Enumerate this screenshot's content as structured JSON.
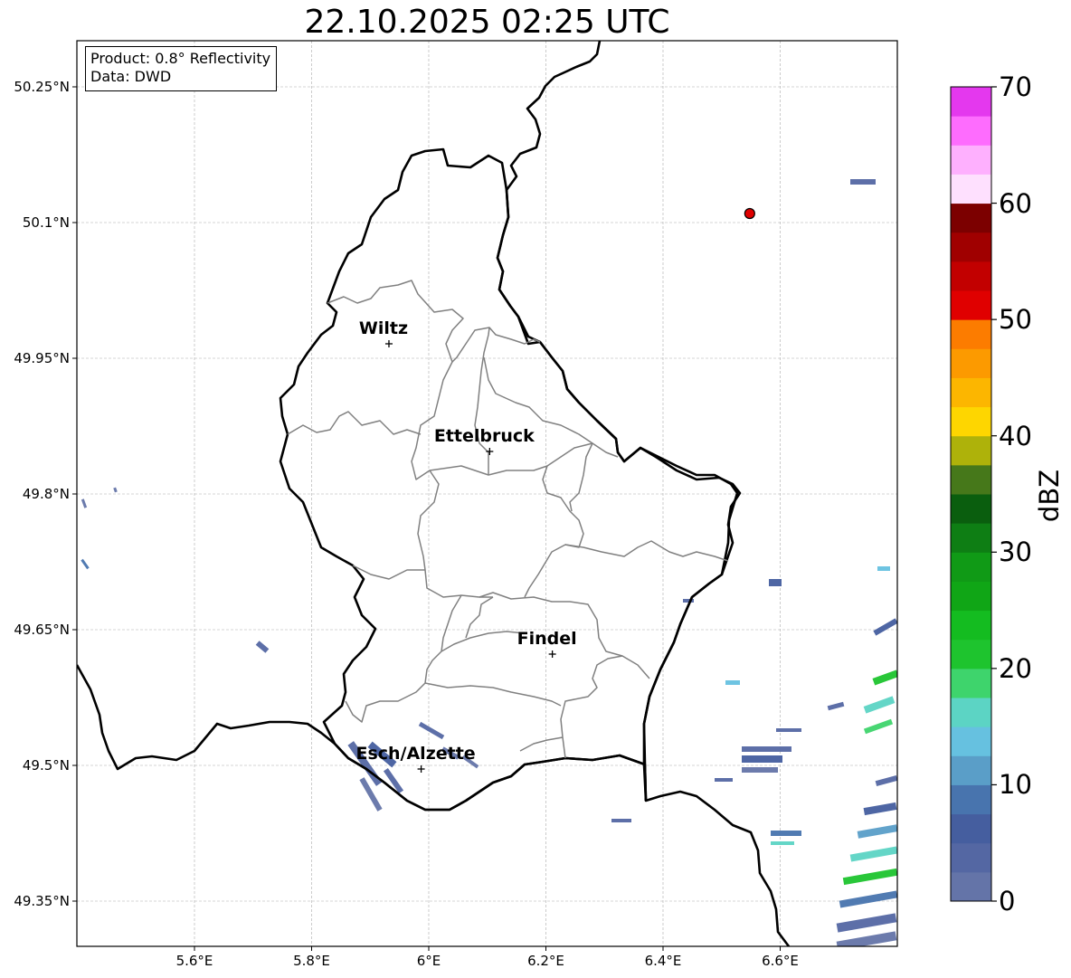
{
  "title": "22.10.2025 02:25 UTC",
  "info_box": {
    "product": "Product: 0.8° Reflectivity",
    "data": "Data: DWD"
  },
  "map": {
    "lon_range": [
      5.4,
      6.8
    ],
    "lat_range": [
      49.3,
      50.3
    ],
    "grid": true,
    "lon_ticks": [
      {
        "value": 5.6,
        "label": "5.6°E"
      },
      {
        "value": 5.8,
        "label": "5.8°E"
      },
      {
        "value": 6.0,
        "label": "6°E"
      },
      {
        "value": 6.2,
        "label": "6.2°E"
      },
      {
        "value": 6.4,
        "label": "6.4°E"
      },
      {
        "value": 6.6,
        "label": "6.6°E"
      }
    ],
    "lat_ticks": [
      {
        "value": 50.25,
        "label": "50.25°N"
      },
      {
        "value": 50.1,
        "label": "50.1°N"
      },
      {
        "value": 49.95,
        "label": "49.95°N"
      },
      {
        "value": 49.8,
        "label": "49.8°N"
      },
      {
        "value": 49.65,
        "label": "49.65°N"
      },
      {
        "value": 49.5,
        "label": "49.5°N"
      },
      {
        "value": 49.35,
        "label": "49.35°N"
      }
    ],
    "cities": [
      {
        "name": "Wiltz",
        "lon": 5.932,
        "lat": 49.966
      },
      {
        "name": "Ettelbruck",
        "lon": 6.104,
        "lat": 49.847
      },
      {
        "name": "Findel",
        "lon": 6.211,
        "lat": 49.623
      },
      {
        "name": "Esch/Alzette",
        "lon": 5.987,
        "lat": 49.496
      }
    ],
    "radar_site": {
      "lon": 6.548,
      "lat": 50.11,
      "color": "#e00000"
    },
    "border_color": "#000000",
    "canton_color": "#808080"
  },
  "colorbar": {
    "label": "dBZ",
    "min": 0,
    "max": 70,
    "ticks": [
      0,
      10,
      20,
      30,
      40,
      50,
      60,
      70
    ],
    "colors": [
      "#6474a8",
      "#5467a3",
      "#455e9f",
      "#4874ae",
      "#5a9ec8",
      "#66c1e0",
      "#5cd4c4",
      "#3ed46c",
      "#1ec42e",
      "#14bc20",
      "#10a616",
      "#109a16",
      "#0e7e14",
      "#0a5e0e",
      "#46781a",
      "#aeb20a",
      "#fed600",
      "#fcb600",
      "#fc9a00",
      "#fc7c00",
      "#e00000",
      "#c20000",
      "#a00000",
      "#7c0000",
      "#fee0fe",
      "#feb0fe",
      "#fe6cfe",
      "#e438ee"
    ]
  }
}
